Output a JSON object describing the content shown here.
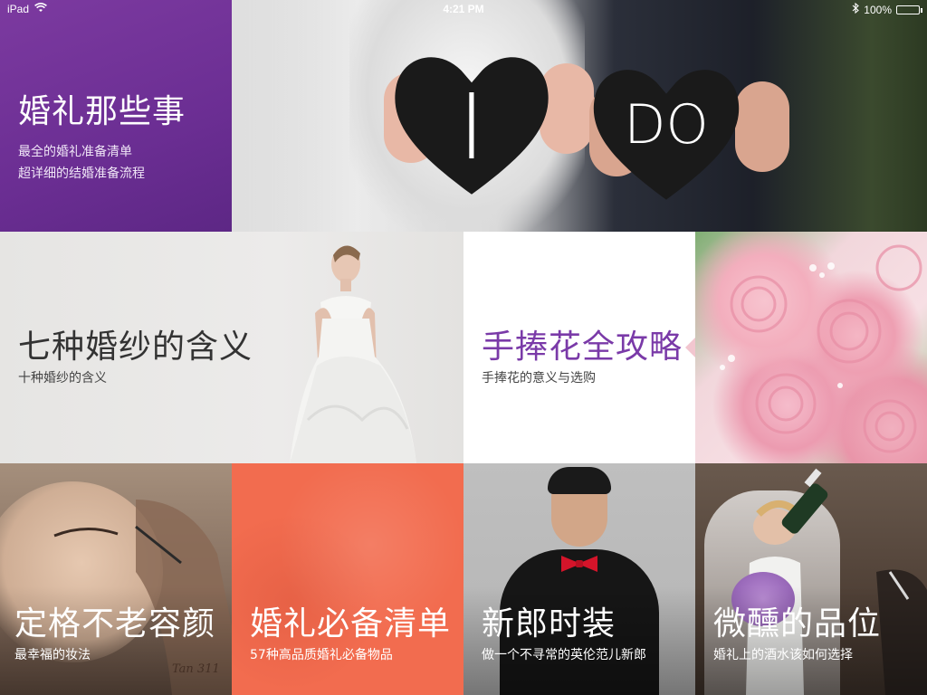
{
  "status_bar": {
    "device": "iPad",
    "time": "4:21 PM",
    "battery": "100%",
    "battery_level": 1.0,
    "icons": [
      "wifi-icon",
      "bluetooth-icon",
      "battery-icon"
    ]
  },
  "tiles": {
    "wedding_things": {
      "title": "婚礼那些事",
      "subtitle_line1": "最全的婚礼准备清单",
      "subtitle_line2": "超详细的结婚准备流程",
      "color": "#6b2e93"
    },
    "i_do_photo": {
      "heart_left_text": "I",
      "heart_right_text": "DO"
    },
    "wedding_dress": {
      "title": "七种婚纱的含义",
      "subtitle": "十种婚纱的含义"
    },
    "bouquet": {
      "title": "手捧花全攻略",
      "subtitle": "手捧花的意义与选购",
      "color": "#7a3aa8"
    },
    "makeup": {
      "title": "定格不老容颜",
      "subtitle": "最幸福的妆法",
      "signature": "Tan 311"
    },
    "checklist": {
      "title": "婚礼必备清单",
      "subtitle": "57种高品质婚礼必备物品",
      "color": "#f26c4f"
    },
    "groom": {
      "title": "新郎时装",
      "subtitle": "做一个不寻常的英伦范儿新郎"
    },
    "wine": {
      "title": "微醺的品位",
      "subtitle": "婚礼上的酒水该如何选择"
    }
  }
}
